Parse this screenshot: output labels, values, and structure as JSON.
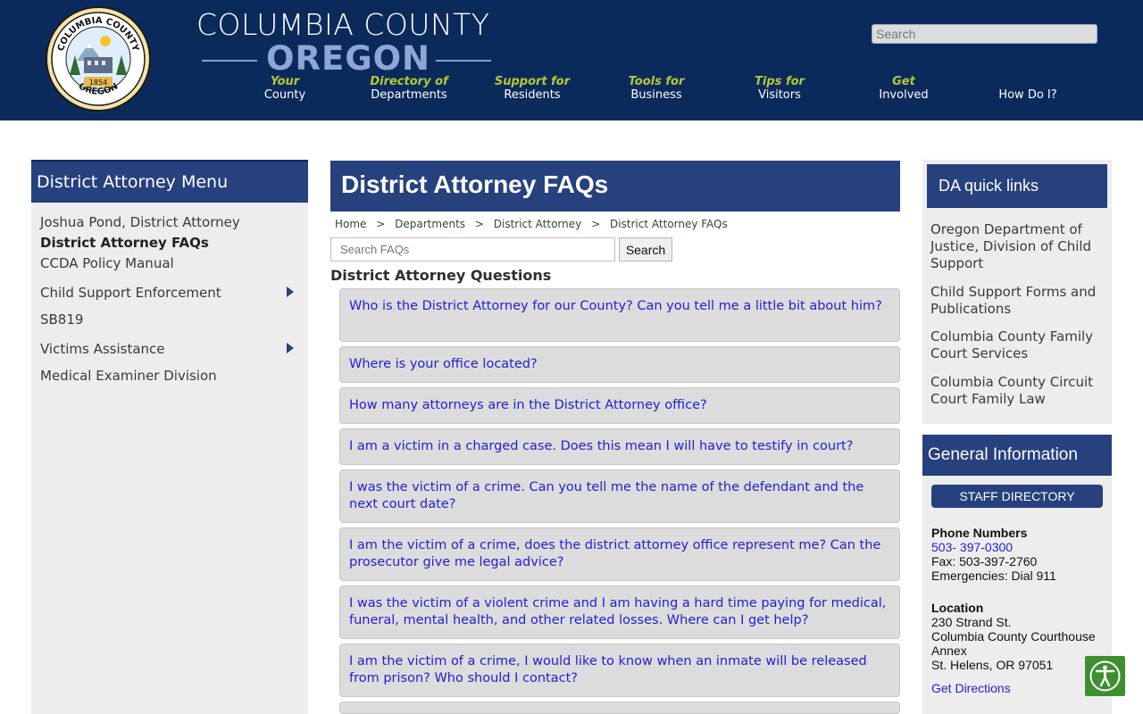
{
  "header": {
    "brand_top": "COLUMBIA COUNTY",
    "brand_bottom": "OREGON",
    "seal_text_top": "COLUMBIA COUNTY",
    "seal_text_bottom": "OREGON",
    "seal_year": "1854",
    "search_placeholder": "Search",
    "nav": [
      {
        "top": "Your",
        "bottom": "County"
      },
      {
        "top": "Directory of",
        "bottom": "Departments"
      },
      {
        "top": "Support for",
        "bottom": "Residents"
      },
      {
        "top": "Tools for",
        "bottom": "Business"
      },
      {
        "top": "Tips for",
        "bottom": "Visitors"
      },
      {
        "top": "Get",
        "bottom": "Involved"
      },
      {
        "top": "",
        "bottom": "How Do I?"
      }
    ]
  },
  "left_menu": {
    "title": "District Attorney Menu",
    "items": [
      {
        "label": "Joshua Pond, District Attorney"
      },
      {
        "label": "District Attorney FAQs"
      },
      {
        "label": "CCDA Policy Manual"
      },
      {
        "label": "Child Support Enforcement"
      },
      {
        "label": "SB819"
      },
      {
        "label": "Victims Assistance"
      },
      {
        "label": "Medical Examiner Division"
      }
    ]
  },
  "main": {
    "title": "District Attorney FAQs",
    "breadcrumb": [
      "Home",
      "Departments",
      "District Attorney",
      "District Attorney FAQs"
    ],
    "breadcrumb_sep": ">",
    "search_placeholder": "Search FAQs",
    "search_button": "Search",
    "questions_heading": "District Attorney Questions",
    "faqs": [
      "Who is the District Attorney for our County? Can you tell me a little bit about him?",
      "Where is your office located?",
      "How many attorneys are in the District Attorney office?",
      "I am a victim in a charged case. Does this mean I will have to testify in court?",
      "I was the victim of a crime. Can you tell me the name of the defendant and the next court date?",
      "I am the victim of a crime, does the district attorney office represent me? Can the prosecutor give me legal advice?",
      "I was the victim of a violent crime and I am having a hard time paying for medical, funeral, mental health, and other related losses. Where can I get help?",
      "I am the victim of a crime, I would like to know when an inmate will be released from prison? Who should I contact?"
    ]
  },
  "quick_links": {
    "title": "DA quick links",
    "links": [
      "Oregon Department of Justice, Division of Child Support",
      "Child Support Forms and Publications",
      "Columbia County Family Court Services",
      "Columbia County Circuit Court Family Law"
    ]
  },
  "general_info": {
    "title": "General Information",
    "staff_button": "STAFF DIRECTORY",
    "phone_heading": "Phone Numbers",
    "phone": "503- 397-0300",
    "fax": "Fax: 503-397-2760",
    "emergency": "Emergencies: Dial 911",
    "location_heading": "Location",
    "address1": "230 Strand St.",
    "address2": "Columbia County Courthouse",
    "address3": "Annex",
    "address4": "St. Helens, OR 97051",
    "directions": "Get Directions"
  },
  "colors": {
    "header_bg": "#0b2a5c",
    "panel_blue": "#26417e",
    "nav_accent": "#b5c837",
    "link_blue": "#2222d0",
    "access_green": "#3e8f2f"
  }
}
